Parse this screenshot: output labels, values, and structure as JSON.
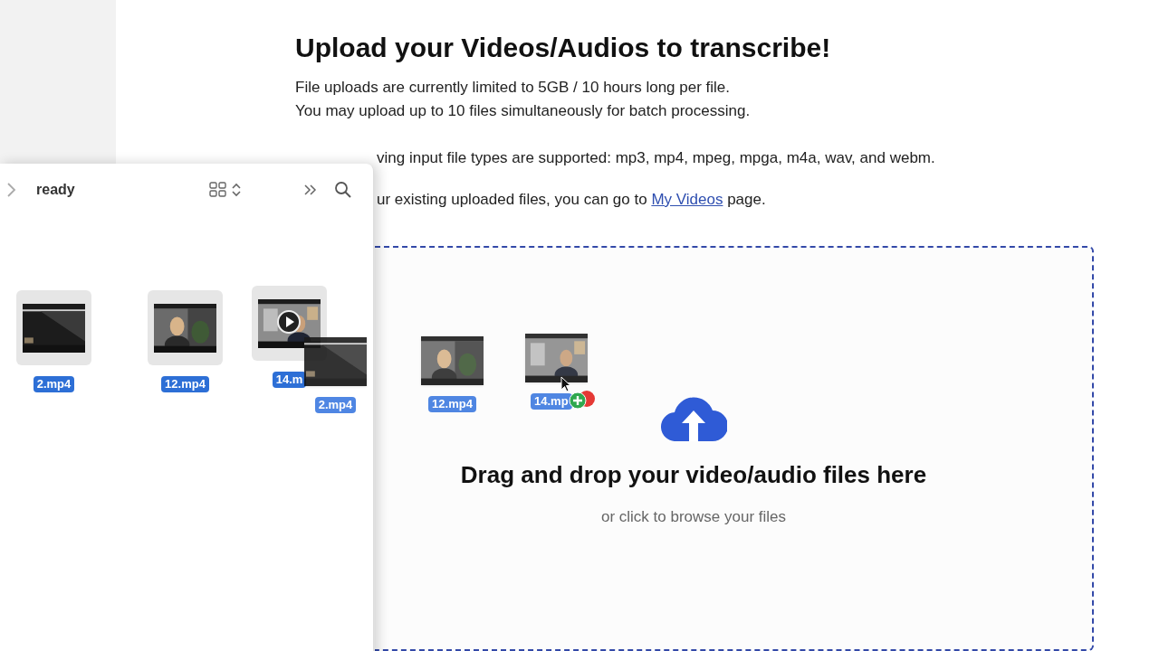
{
  "page": {
    "heading": "Upload your Videos/Audios to transcribe!",
    "lines": [
      "File uploads are currently limited to 5GB / 10 hours long per file.",
      "You may upload up to 10 files simultaneously for batch processing."
    ],
    "partial_line": "ving input file types are supported: mp3, mp4, mpeg, mpga, m4a, wav, and webm.",
    "link_line": {
      "before": "ur existing uploaded files, you can go to ",
      "link": "My Videos",
      "after": " page."
    }
  },
  "dropzone": {
    "title": "Drag and drop your video/audio files here",
    "subtitle": "or click to browse your files"
  },
  "finder": {
    "folder": "ready",
    "files": [
      {
        "name": "2.mp4",
        "selected": true,
        "play": false
      },
      {
        "name": "12.mp4",
        "selected": true,
        "play": false
      },
      {
        "name": "14.m",
        "selected": true,
        "play": true
      }
    ]
  },
  "drag": {
    "items": [
      {
        "name": "2.mp4"
      },
      {
        "name": "12.mp4"
      },
      {
        "name": "14.mp"
      }
    ],
    "copy_badge": true
  }
}
